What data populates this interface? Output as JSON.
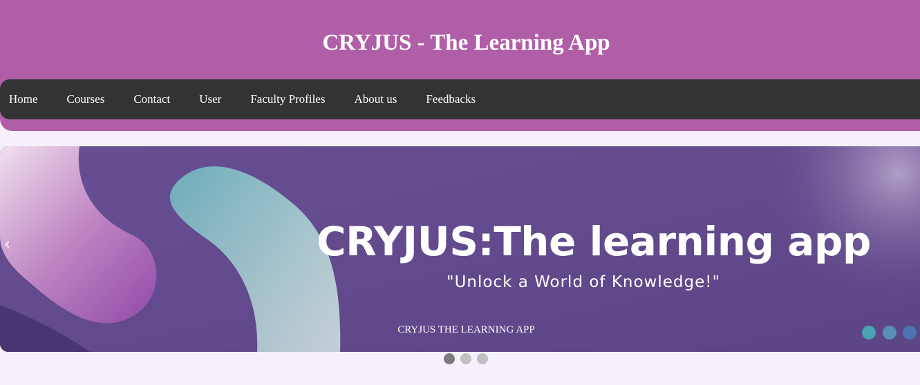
{
  "header": {
    "title": "CRYJUS - The Learning App"
  },
  "nav": {
    "items": [
      "Home",
      "Courses",
      "Contact",
      "User",
      "Faculty Profiles",
      "About us",
      "Feedbacks"
    ]
  },
  "carousel": {
    "banner_title": "CRYJUS:The learning app",
    "banner_subtitle": "\"Unlock a World of Knowledge!\"",
    "caption": "CRYJUS THE LEARNING APP",
    "prev_icon": "‹",
    "slide_count": 3,
    "active_slide": 1
  },
  "colors": {
    "header_bg": "#b15ea8",
    "nav_bg": "#333333",
    "page_bg": "#f6f0fc",
    "banner_bg": "#674e93"
  }
}
